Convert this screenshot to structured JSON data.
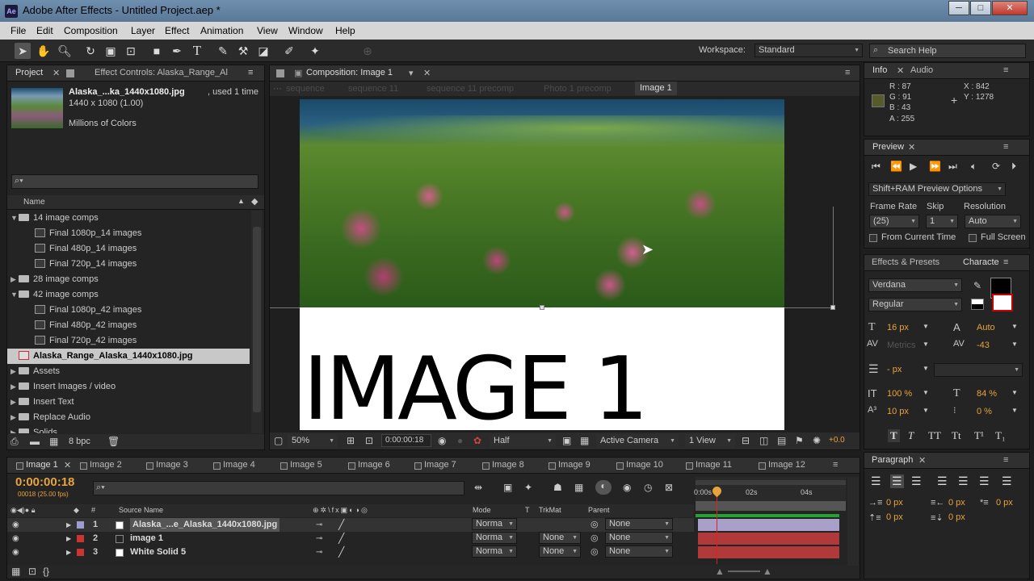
{
  "window": {
    "title": "Adobe After Effects - Untitled Project.aep *",
    "logo": "Ae",
    "min": "─",
    "max": "□",
    "close": "✕"
  },
  "menu": [
    "File",
    "Edit",
    "Composition",
    "Layer",
    "Effect",
    "Animation",
    "View",
    "Window",
    "Help"
  ],
  "toolbar": {
    "workspace_label": "Workspace:",
    "workspace_value": "Standard",
    "search_placeholder": "Search Help"
  },
  "project": {
    "tab_project": "Project",
    "tab_effect": "Effect Controls: Alaska_Range_Al",
    "asset_name": "Alaska_...ka_1440x1080.jpg",
    "asset_used": ", used 1 time",
    "asset_dims": "1440 x 1080 (1.00)",
    "asset_colors": "Millions of Colors",
    "column_name": "Name",
    "bpc": "8 bpc",
    "items": [
      {
        "label": "14 image comps",
        "type": "folder",
        "indent": 0,
        "open": true
      },
      {
        "label": "Final 1080p_14 images",
        "type": "comp",
        "indent": 1
      },
      {
        "label": "Final 480p_14 images",
        "type": "comp",
        "indent": 1
      },
      {
        "label": "Final 720p_14 images",
        "type": "comp",
        "indent": 1
      },
      {
        "label": "28 image comps",
        "type": "folder",
        "indent": 0,
        "open": false
      },
      {
        "label": "42 image comps",
        "type": "folder",
        "indent": 0,
        "open": true
      },
      {
        "label": "Final 1080p_42 images",
        "type": "comp",
        "indent": 1
      },
      {
        "label": "Final 480p_42 images",
        "type": "comp",
        "indent": 1
      },
      {
        "label": "Final 720p_42 images",
        "type": "comp",
        "indent": 1
      },
      {
        "label": "Alaska_Range_Alaska_1440x1080.jpg",
        "type": "image",
        "indent": 0,
        "selected": true
      },
      {
        "label": "Assets",
        "type": "folder",
        "indent": 0,
        "open": false
      },
      {
        "label": "Insert Images / video",
        "type": "folder",
        "indent": 0,
        "open": false
      },
      {
        "label": "Insert Text",
        "type": "folder",
        "indent": 0,
        "open": false
      },
      {
        "label": "Replace Audio",
        "type": "folder",
        "indent": 0,
        "open": false
      },
      {
        "label": "Solids",
        "type": "folder",
        "indent": 0,
        "open": false
      }
    ]
  },
  "composition": {
    "tab_label": "Composition: Image 1",
    "breadcrumbs": [
      "sequence",
      "sequence 11",
      "sequence 11 precomp",
      "Photo 1 precomp",
      "Image 1"
    ],
    "canvas_text": "IMAGE 1",
    "zoom": "50%",
    "timecode": "0:00:00:18",
    "resolution": "Half",
    "camera": "Active Camera",
    "view": "1 View",
    "exposure": "+0.0"
  },
  "info": {
    "tab_info": "Info",
    "tab_audio": "Audio",
    "r": "R : 87",
    "g": "G : 91",
    "b": "B : 43",
    "a": "A : 255",
    "x": "X : 842",
    "y": "Y : 1278",
    "swatch": "#575b2b"
  },
  "preview": {
    "tab": "Preview",
    "options": "Shift+RAM Preview Options",
    "frame_rate_label": "Frame Rate",
    "skip_label": "Skip",
    "resolution_label": "Resolution",
    "frame_rate": "(25)",
    "skip": "1",
    "resolution": "Auto",
    "from_current": "From Current Time",
    "full_screen": "Full Screen"
  },
  "character": {
    "tab_effects": "Effects & Presets",
    "tab_char": "Characte",
    "font": "Verdana",
    "style": "Regular",
    "size": "16 px",
    "leading": "Auto",
    "kerning": "Metrics",
    "tracking": "-43",
    "stroke": "- px",
    "vscale": "100 %",
    "hscale": "84 %",
    "baseline": "10 px",
    "tsume": "0 %"
  },
  "paragraph": {
    "tab": "Paragraph",
    "v1": "0 px",
    "v2": "0 px",
    "v3": "0 px",
    "v4": "0 px",
    "v5": "0 px"
  },
  "timeline": {
    "tabs": [
      "Image 1",
      "Image 2",
      "Image 3",
      "Image 4",
      "Image 5",
      "Image 6",
      "Image 7",
      "Image 8",
      "Image 9",
      "Image 10",
      "Image 11",
      "Image 12"
    ],
    "timecode": "0:00:00:18",
    "frames": "00018 (25.00 fps)",
    "columns": {
      "source": "Source Name",
      "mode": "Mode",
      "t": "T",
      "trkmat": "TrkMat",
      "parent": "Parent",
      "num": "#"
    },
    "ruler": [
      "0:00s",
      "02s",
      "04s"
    ],
    "layers": [
      {
        "num": "1",
        "name": "Alaska_...e_Alaska_1440x1080.jpg",
        "mode": "Norma",
        "trkmat": "",
        "parent": "None",
        "color": "#9c9cd0",
        "bar": "#a8a0c8"
      },
      {
        "num": "2",
        "name": "image 1",
        "mode": "Norma",
        "trkmat": "None",
        "parent": "None",
        "color": "#cc3333",
        "bar": "#b03a3a"
      },
      {
        "num": "3",
        "name": "White Solid 5",
        "mode": "Norma",
        "trkmat": "None",
        "parent": "None",
        "color": "#cc3333",
        "bar": "#b03a3a"
      }
    ]
  }
}
